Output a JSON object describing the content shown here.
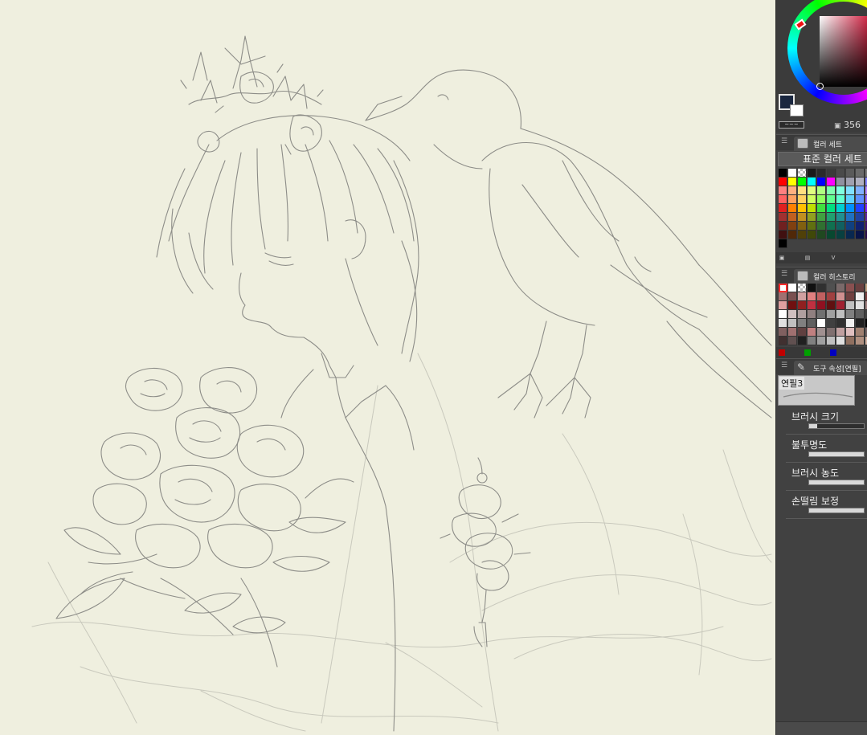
{
  "color_circle": {
    "hue_readout": "356",
    "foreground_color": "#1a2740",
    "background_color": "#ffffff",
    "accent_color": "#d02040"
  },
  "color_set": {
    "tab_label": "컬러 세트",
    "selector_label": "표준 컬러 세트",
    "tab_icon": "palette-icon",
    "swatches": [
      [
        "#000000",
        "#ffffff",
        "checker",
        "#1a1a1a",
        "#2a2a2a",
        "#3a3a3a",
        "#4a4a4a",
        "#5a5a5a",
        "#6a6a6a",
        "#7a7a7a"
      ],
      [
        "#ff0000",
        "#ffff00",
        "#00ff00",
        "#00ffff",
        "#0000ff",
        "#ff00ff",
        "#9090a0",
        "#a0a0b0",
        "#b0b0c0",
        "#8080ff"
      ],
      [
        "#ff8080",
        "#ffb080",
        "#ffe080",
        "#e0ff80",
        "#b0ff80",
        "#80ffb0",
        "#80ffe0",
        "#80e0ff",
        "#80b0ff",
        "#b080ff"
      ],
      [
        "#ff6060",
        "#ffa060",
        "#ffd060",
        "#d0ff60",
        "#90ff60",
        "#60ff90",
        "#60ffd0",
        "#60d0ff",
        "#6090ff",
        "#9060ff"
      ],
      [
        "#e02020",
        "#ff8000",
        "#ffc000",
        "#c0e000",
        "#40e040",
        "#00e080",
        "#00d0d0",
        "#0090ff",
        "#2040ff",
        "#8020ff"
      ],
      [
        "#a03030",
        "#c06020",
        "#c09020",
        "#90a020",
        "#40a040",
        "#20a070",
        "#209090",
        "#2070c0",
        "#2040a0",
        "#6020a0"
      ],
      [
        "#702020",
        "#804010",
        "#806010",
        "#607010",
        "#307030",
        "#107050",
        "#106060",
        "#104080",
        "#102070",
        "#401070"
      ],
      [
        "#401010",
        "#502808",
        "#504008",
        "#404808",
        "#204820",
        "#084830",
        "#084040",
        "#082850",
        "#081448",
        "#280848"
      ],
      [
        "#000000"
      ]
    ]
  },
  "color_set_toolbar": [
    "disk-icon",
    "trash-icon",
    "check-icon"
  ],
  "color_history": {
    "tab_label": "컬러 히스토리",
    "tab_icon": "history-icon",
    "swatches": [
      [
        "#ffffff",
        "#ffffff",
        "checker",
        "#101010",
        "#303030",
        "#505050",
        "#7a6a6a",
        "#8a5050",
        "#6a4040",
        "#c0a080"
      ],
      [
        "#a07070",
        "#7a5050",
        "#d0a0a0",
        "#e08080",
        "#c06060",
        "#a04040",
        "#d09090",
        "#704040",
        "#f0f0f0",
        "#804040"
      ],
      [
        "#e0a0a0",
        "#701010",
        "#902020",
        "#c03040",
        "#901020",
        "#601010",
        "#a02030",
        "#c0c0c0",
        "#e0e0e0",
        "#a08080"
      ],
      [
        "#ffffff",
        "#d0c0c0",
        "#b0a0a0",
        "#908080",
        "#707070",
        "#a0a0a0",
        "#c0c0c0",
        "#808080",
        "#606060",
        "#404040"
      ],
      [
        "#e0e0e0",
        "#c0c0c0",
        "#808080",
        "#606060",
        "#ffffff",
        "#404040",
        "#303030",
        "#f0f0f0",
        "#202020",
        "#000000"
      ],
      [
        "#806060",
        "#a07070",
        "#604040",
        "#c08080",
        "#a09090",
        "#807070",
        "#c0a0a0",
        "#e0c0c0",
        "#a08070",
        "#706060"
      ],
      [
        "#403030",
        "#605050",
        "#202020",
        "#808080",
        "#a0a0a0",
        "#c0c0c0",
        "#e0e0e0",
        "#907060",
        "#b09080",
        "#d0b0a0"
      ]
    ],
    "footer_colors": [
      "#c00000",
      "#00a000",
      "#0000c0"
    ]
  },
  "tool_property": {
    "tab_label": "도구 속성[연필]",
    "tab_icon": "pencil-icon",
    "brush_name": "연필3",
    "properties": [
      {
        "label": "브러시 크기",
        "value": 0.15
      },
      {
        "label": "불투명도",
        "value": 1.0
      },
      {
        "label": "브러시 농도",
        "value": 1.0
      },
      {
        "label": "손떨림 보정",
        "value": 1.0
      }
    ]
  }
}
